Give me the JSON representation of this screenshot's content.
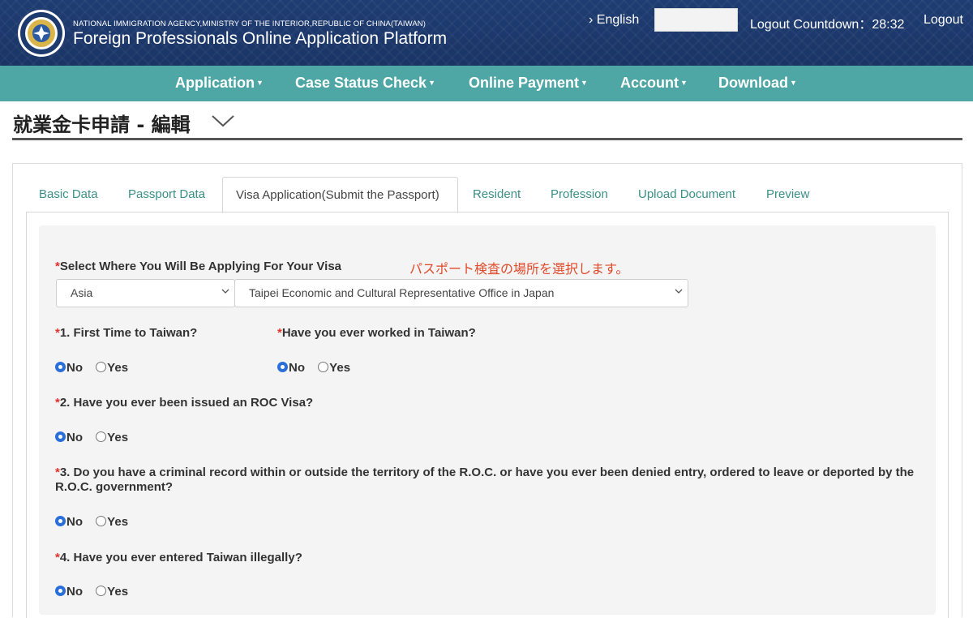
{
  "header": {
    "agency": "NATIONAL IMMIGRATION AGENCY,MINISTRY OF THE INTERIOR,REPUBLIC OF CHINA(TAIWAN)",
    "platform_title": "Foreign Professionals Online Application Platform",
    "language_link": "English",
    "countdown_label": "Logout Countdown：28:32",
    "logout_label": "Logout",
    "logo_icon": "national-immigration-agency-seal-icon"
  },
  "nav": {
    "items": [
      {
        "label": "Application"
      },
      {
        "label": "Case Status Check"
      },
      {
        "label": "Online Payment"
      },
      {
        "label": "Account"
      },
      {
        "label": "Download"
      }
    ],
    "background": "#4ea7a4"
  },
  "page": {
    "title": "就業金卡申請 - 編輯"
  },
  "tabs": [
    {
      "label": "Basic Data"
    },
    {
      "label": "Passport Data"
    },
    {
      "label": "Visa Application(Submit the Passport)",
      "active": true
    },
    {
      "label": "Resident"
    },
    {
      "label": "Profession"
    },
    {
      "label": "Upload Document"
    },
    {
      "label": "Preview"
    }
  ],
  "form": {
    "visa_location_label": "Select Where You Will Be Applying For Your Visa",
    "required_mark": "*",
    "annotation_jp": "パスポート検査の場所を選択します。",
    "region_select_value": "Asia",
    "office_select_value": "Taipei Economic and Cultural Representative Office in Japan",
    "q1_label": "1. First Time to Taiwan?",
    "q_worked_label": "Have you ever worked in Taiwan?",
    "q2_label": "2. Have you ever been issued an ROC Visa?",
    "q3_label": "3. Do you have a criminal record within or outside the territory of the R.O.C. or have you ever been denied entry, ordered to leave or deported by the R.O.C. government?",
    "q4_label": "4. Have you ever entered Taiwan illegally?",
    "no_label": "No",
    "yes_label": "Yes"
  }
}
